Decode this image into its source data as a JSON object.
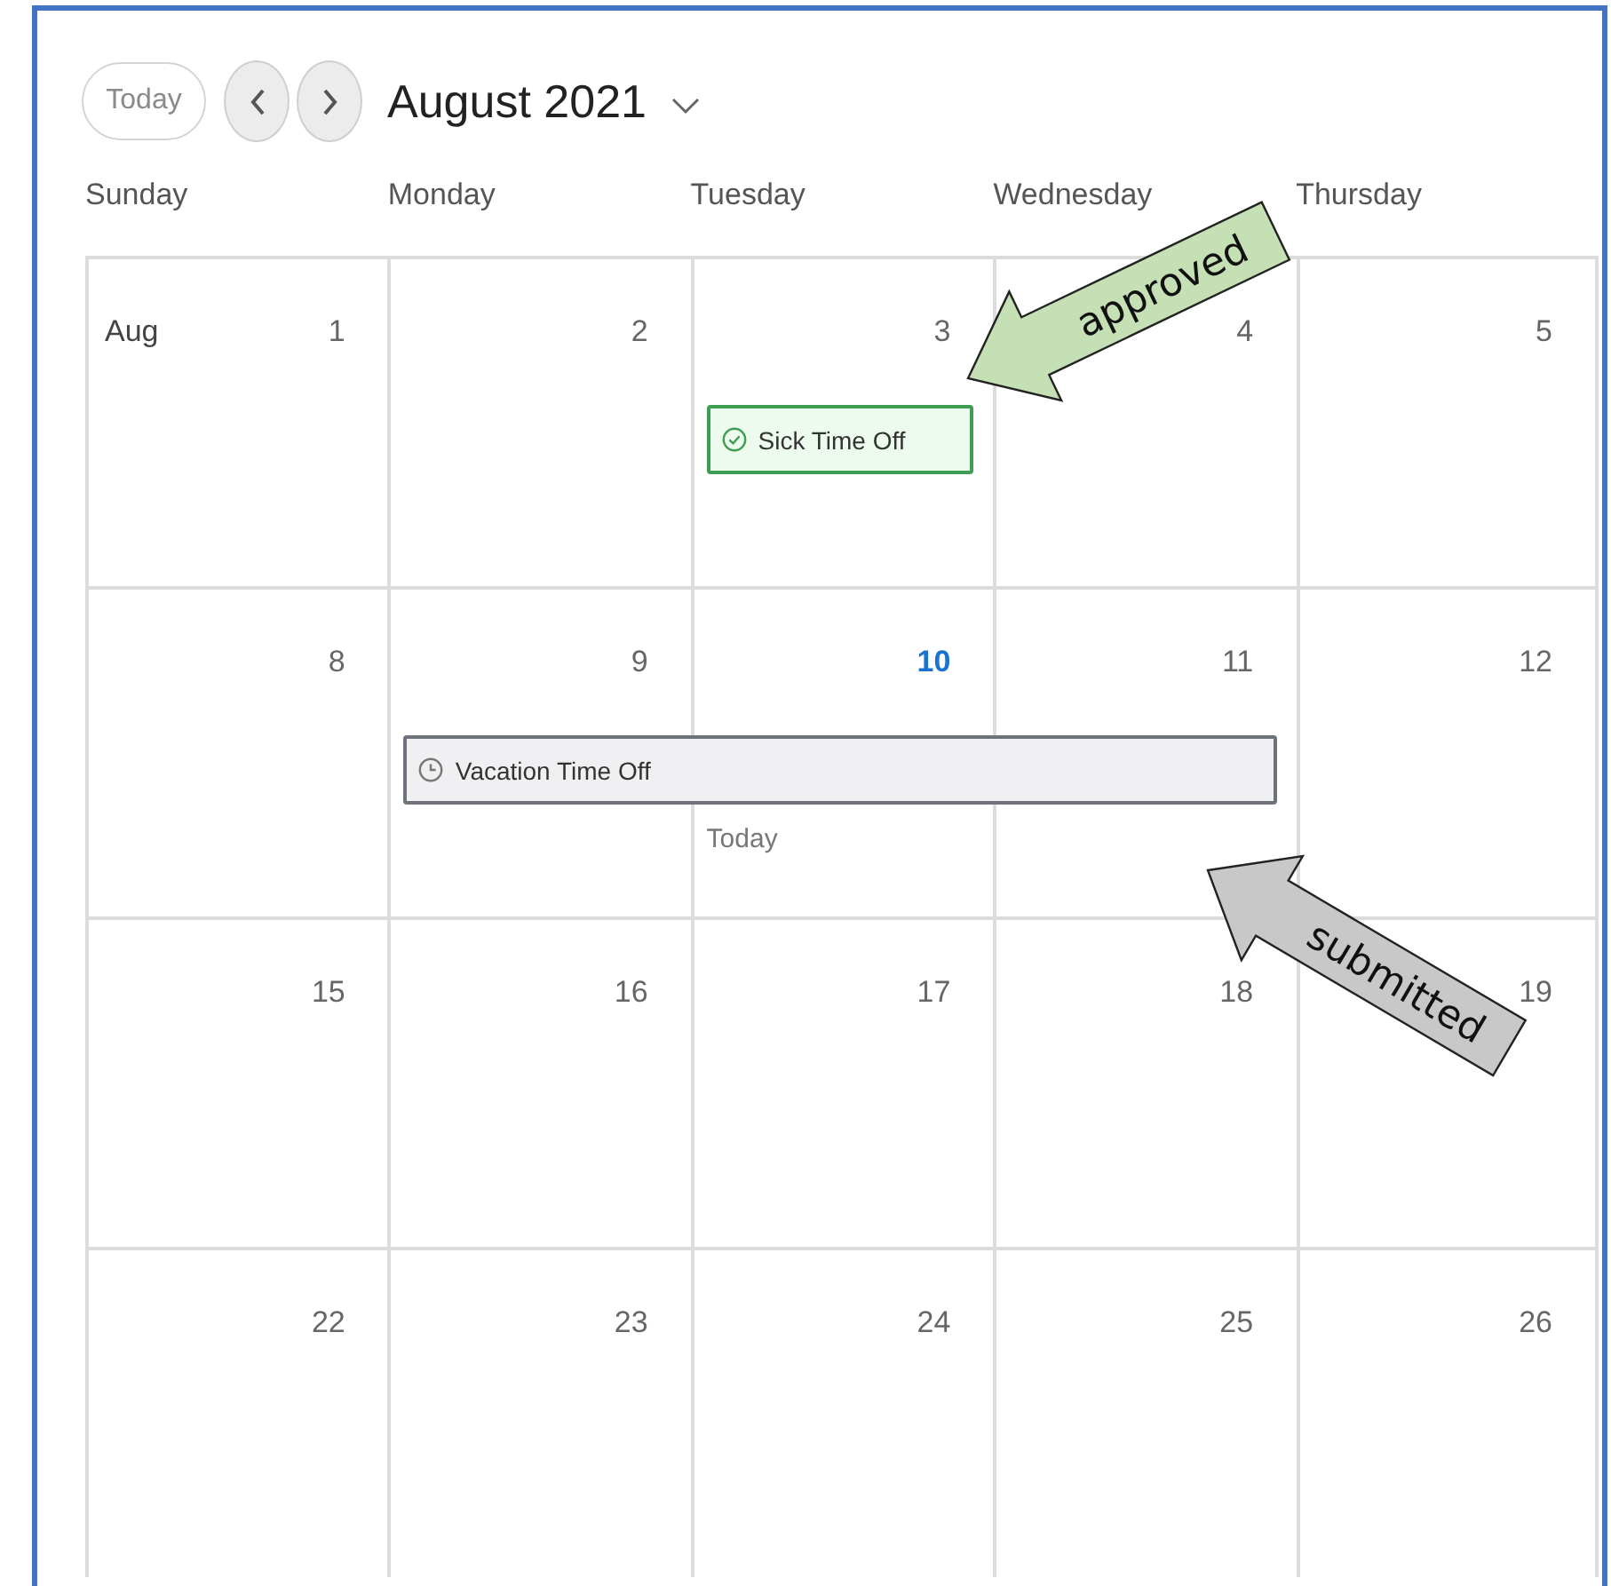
{
  "toolbar": {
    "today_button": "Today",
    "title": "August 2021"
  },
  "weekdays": [
    "Sunday",
    "Monday",
    "Tuesday",
    "Wednesday",
    "Thursday"
  ],
  "weeks": [
    {
      "days": [
        {
          "date": "1",
          "month_label": "Aug"
        },
        {
          "date": "2"
        },
        {
          "date": "3",
          "events": [
            {
              "label": "Sick Time Off",
              "kind": "approved"
            }
          ]
        },
        {
          "date": "4"
        },
        {
          "date": "5"
        }
      ]
    },
    {
      "days": [
        {
          "date": "8"
        },
        {
          "date": "9",
          "events": [
            {
              "label": "Vacation Time Off",
              "kind": "submitted"
            }
          ]
        },
        {
          "date": "10",
          "today": true,
          "today_label": "Today",
          "event_continues": true
        },
        {
          "date": "11",
          "event_continues": true
        },
        {
          "date": "12"
        }
      ]
    },
    {
      "days": [
        {
          "date": "15"
        },
        {
          "date": "16"
        },
        {
          "date": "17"
        },
        {
          "date": "18"
        },
        {
          "date": "19"
        }
      ]
    },
    {
      "days": [
        {
          "date": "22"
        },
        {
          "date": "23"
        },
        {
          "date": "24"
        },
        {
          "date": "25"
        },
        {
          "date": "26"
        }
      ]
    }
  ],
  "annotations": [
    {
      "text": "approved",
      "color": "#c5e0b4"
    },
    {
      "text": "submitted",
      "color": "#c8c8c8"
    }
  ]
}
